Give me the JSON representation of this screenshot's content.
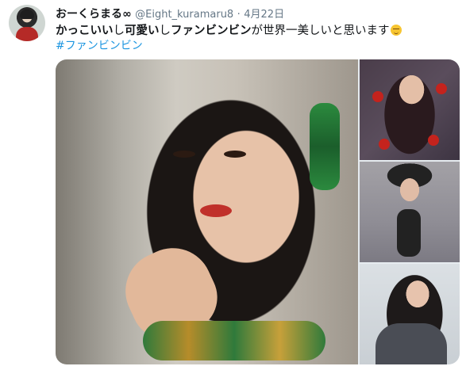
{
  "tweet": {
    "display_name": "おーくらまる∞",
    "handle": "@Eight_kuramaru8",
    "separator": "·",
    "date": "4月22日",
    "text_parts": [
      {
        "text": "かっこいい",
        "bold": true
      },
      {
        "text": "し",
        "bold": false
      },
      {
        "text": "可愛い",
        "bold": true
      },
      {
        "text": "し",
        "bold": false
      },
      {
        "text": "ファンビンビン",
        "bold": true
      },
      {
        "text": "が世界一美しいと思います",
        "bold": false
      }
    ],
    "emoji": "relieved-face-emoji",
    "hashtag": "#ファンビンビン"
  },
  "media": {
    "photo_count": 4
  },
  "colors": {
    "text": "#14171a",
    "muted": "#657786",
    "link": "#1b95e0"
  }
}
